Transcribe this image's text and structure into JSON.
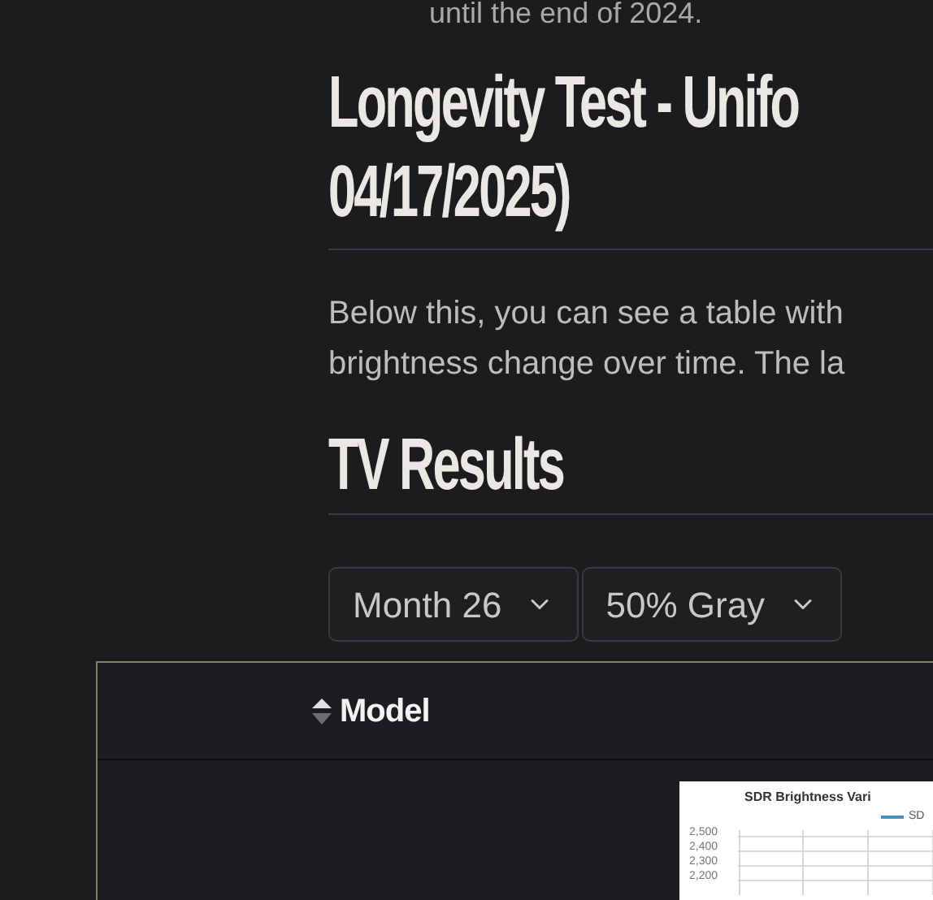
{
  "intro_tail": "until the end of 2024.",
  "heading": {
    "lines": [
      "Longevity Test - Unifo",
      "04/17/2025)"
    ]
  },
  "paragraph": {
    "lines": [
      "Below this, you can see a table with",
      "brightness change over time. The la"
    ]
  },
  "section_heading": "TV Results",
  "filters": [
    {
      "value": "Month 26"
    },
    {
      "value": "50% Gray"
    }
  ],
  "table": {
    "columns": [
      {
        "label": "Model",
        "sortable": true
      }
    ],
    "thumbnail": {
      "title": "SDR Brightness Vari",
      "legend": "SD",
      "y_labels": [
        "2,500",
        "2,400",
        "2,300",
        "2,200"
      ]
    }
  }
}
